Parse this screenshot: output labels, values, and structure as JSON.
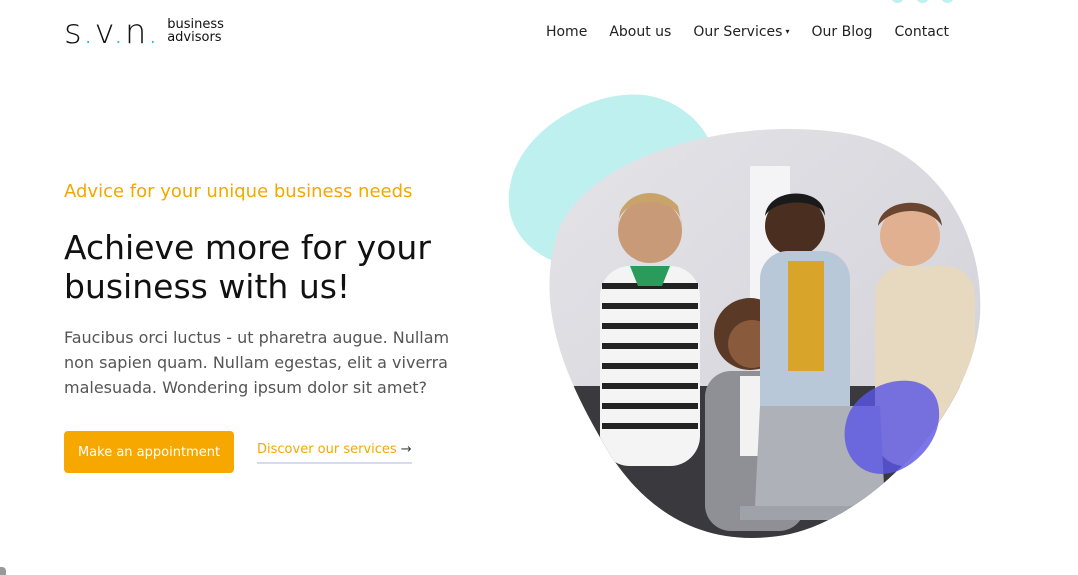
{
  "header": {
    "logo": {
      "mark_s": "s",
      "mark_v": "v",
      "mark_n": "n",
      "dot": ".",
      "line1": "business",
      "line2": "advisors"
    },
    "nav": [
      {
        "label": "Home"
      },
      {
        "label": "About us"
      },
      {
        "label": "Our Services",
        "caret": "▾"
      },
      {
        "label": "Our Blog"
      },
      {
        "label": "Contact"
      }
    ]
  },
  "hero": {
    "kicker": "Advice for your unique business needs",
    "headline": "Achieve more for your business with us!",
    "body": "Faucibus orci luctus - ut pharetra augue. Nullam non sapien quam. Nullam egestas, elit a viverra malesuada. Wondering ipsum dolor sit amet?",
    "primary_button": "Make an appointment",
    "secondary_link": "Discover our services",
    "secondary_arrow": "→"
  },
  "colors": {
    "accent": "#f7a800",
    "teal_blob": "#bdf0ee",
    "purple_blob": "#5a55e6",
    "logo_dot": "#2cc0b8"
  },
  "icons": [
    "chevron-down-icon",
    "arrow-right-icon"
  ]
}
